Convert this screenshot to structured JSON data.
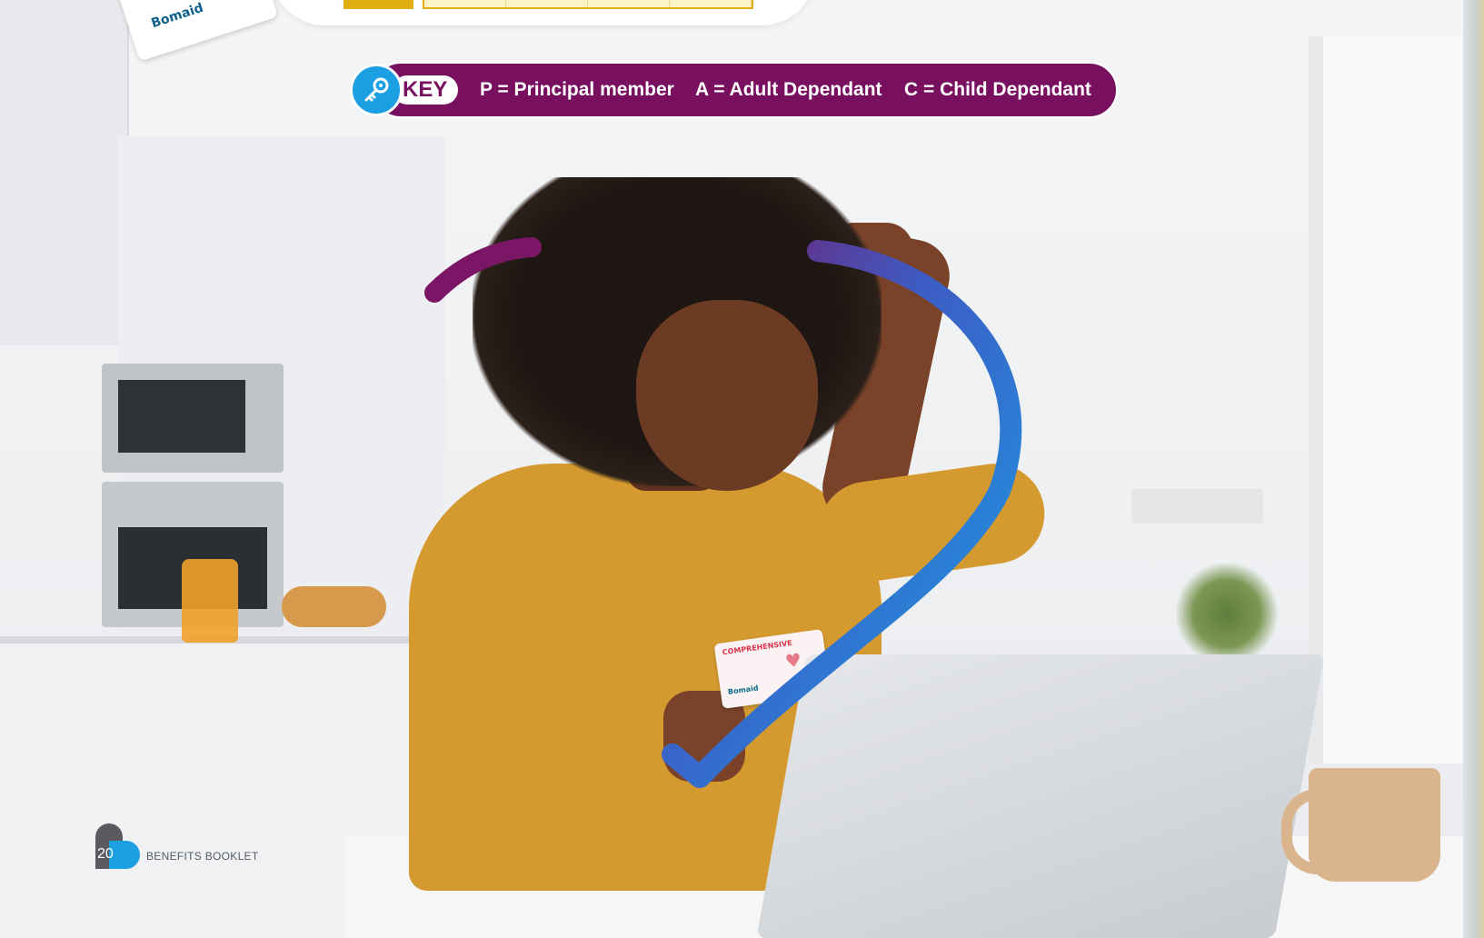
{
  "key": {
    "label": "KEY",
    "items": [
      {
        "code": "P",
        "text": "P = Principal member"
      },
      {
        "code": "A",
        "text": "A = Adult Dependant"
      },
      {
        "code": "C",
        "text": "C = Child Dependant"
      }
    ]
  },
  "card": {
    "label": "COMPREHENSIVE",
    "brand": "Bomaid"
  },
  "top_card": {
    "brand": "Bomaid"
  },
  "footer": {
    "page_number": "20",
    "label": "BENEFITS BOOKLET"
  },
  "colors": {
    "key_bar": "#79105f",
    "accent_blue": "#1d9fe3",
    "gold": "#e0ae10"
  }
}
